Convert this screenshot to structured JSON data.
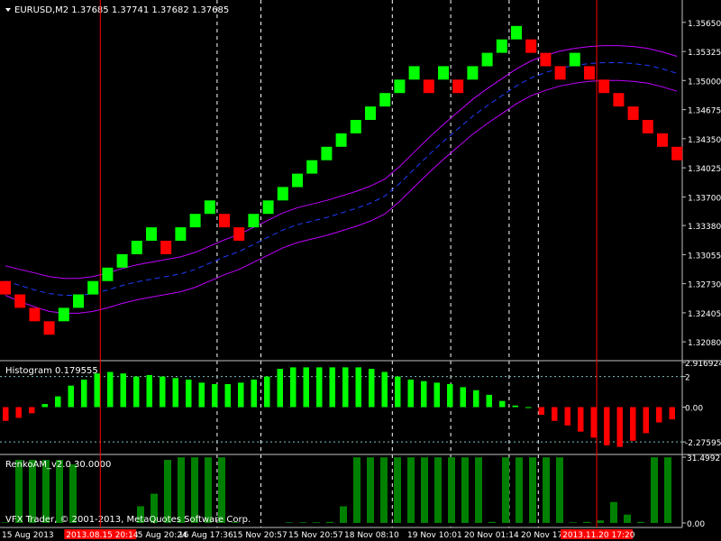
{
  "window": {
    "symbol_line": "EURUSD,M2  1.37685 1.37741 1.37682 1.37685",
    "copyright": "VFX Trader, © 2001-2013, MetaQuotes Software Corp."
  },
  "colors": {
    "background": "#000000",
    "up": "#00ff00",
    "down": "#ff0000",
    "hist_pos": "#00ff00",
    "hist_neg": "#ff0000",
    "renko_am": "#008000",
    "band": "#c000ff",
    "mid": "#1e3cff",
    "vline": "#ffffff",
    "marker": "#ff0000",
    "axis": "#c0c0c0"
  },
  "chart_data": [
    {
      "type": "renko",
      "title": "EURUSD,M2",
      "ylim": [
        1.3188,
        1.359
      ],
      "y_ticks": [
        "1.35650",
        "1.35325",
        "1.35000",
        "1.34675",
        "1.34350",
        "1.34025",
        "1.33700",
        "1.33380",
        "1.33055",
        "1.32730",
        "1.32405",
        "1.32080"
      ],
      "bricks": [
        {
          "d": "down",
          "o": 1.3276,
          "c": 1.3261
        },
        {
          "d": "down",
          "o": 1.3261,
          "c": 1.3246
        },
        {
          "d": "down",
          "o": 1.3246,
          "c": 1.3231
        },
        {
          "d": "down",
          "o": 1.3231,
          "c": 1.3216
        },
        {
          "d": "up",
          "o": 1.3231,
          "c": 1.3246
        },
        {
          "d": "up",
          "o": 1.3246,
          "c": 1.3261
        },
        {
          "d": "up",
          "o": 1.3261,
          "c": 1.3276
        },
        {
          "d": "up",
          "o": 1.3276,
          "c": 1.3291
        },
        {
          "d": "up",
          "o": 1.3291,
          "c": 1.3306
        },
        {
          "d": "up",
          "o": 1.3306,
          "c": 1.3321
        },
        {
          "d": "up",
          "o": 1.3321,
          "c": 1.3336
        },
        {
          "d": "down",
          "o": 1.3321,
          "c": 1.3306
        },
        {
          "d": "up",
          "o": 1.3321,
          "c": 1.3336
        },
        {
          "d": "up",
          "o": 1.3336,
          "c": 1.3351
        },
        {
          "d": "up",
          "o": 1.3351,
          "c": 1.3366
        },
        {
          "d": "down",
          "o": 1.3351,
          "c": 1.3336
        },
        {
          "d": "down",
          "o": 1.3336,
          "c": 1.3321
        },
        {
          "d": "up",
          "o": 1.3336,
          "c": 1.3351
        },
        {
          "d": "up",
          "o": 1.3351,
          "c": 1.3366
        },
        {
          "d": "up",
          "o": 1.3366,
          "c": 1.3381
        },
        {
          "d": "up",
          "o": 1.3381,
          "c": 1.3396
        },
        {
          "d": "up",
          "o": 1.3396,
          "c": 1.3411
        },
        {
          "d": "up",
          "o": 1.3411,
          "c": 1.3426
        },
        {
          "d": "up",
          "o": 1.3426,
          "c": 1.3441
        },
        {
          "d": "up",
          "o": 1.3441,
          "c": 1.3456
        },
        {
          "d": "up",
          "o": 1.3456,
          "c": 1.3471
        },
        {
          "d": "up",
          "o": 1.3471,
          "c": 1.3486
        },
        {
          "d": "up",
          "o": 1.3486,
          "c": 1.3501
        },
        {
          "d": "up",
          "o": 1.3501,
          "c": 1.3516
        },
        {
          "d": "down",
          "o": 1.3501,
          "c": 1.3486
        },
        {
          "d": "up",
          "o": 1.3501,
          "c": 1.3516
        },
        {
          "d": "down",
          "o": 1.3501,
          "c": 1.3486
        },
        {
          "d": "up",
          "o": 1.3501,
          "c": 1.3516
        },
        {
          "d": "up",
          "o": 1.3516,
          "c": 1.3531
        },
        {
          "d": "up",
          "o": 1.3531,
          "c": 1.3546
        },
        {
          "d": "up",
          "o": 1.3546,
          "c": 1.3561
        },
        {
          "d": "down",
          "o": 1.3546,
          "c": 1.3531
        },
        {
          "d": "down",
          "o": 1.3531,
          "c": 1.3516
        },
        {
          "d": "down",
          "o": 1.3516,
          "c": 1.3501
        },
        {
          "d": "up",
          "o": 1.3516,
          "c": 1.3531
        },
        {
          "d": "down",
          "o": 1.3516,
          "c": 1.3501
        },
        {
          "d": "down",
          "o": 1.3501,
          "c": 1.3486
        },
        {
          "d": "down",
          "o": 1.3486,
          "c": 1.3471
        },
        {
          "d": "down",
          "o": 1.3471,
          "c": 1.3456
        },
        {
          "d": "down",
          "o": 1.3456,
          "c": 1.3441
        },
        {
          "d": "down",
          "o": 1.3441,
          "c": 1.3426
        },
        {
          "d": "down",
          "o": 1.3426,
          "c": 1.3411
        }
      ],
      "bands": {
        "upper": [
          1.3293,
          1.3289,
          1.3285,
          1.3281,
          1.3279,
          1.3279,
          1.3281,
          1.3285,
          1.329,
          1.3294,
          1.3297,
          1.33,
          1.3303,
          1.3308,
          1.3315,
          1.3322,
          1.3328,
          1.3336,
          1.3344,
          1.3352,
          1.3358,
          1.3362,
          1.3366,
          1.3371,
          1.3376,
          1.3382,
          1.339,
          1.3404,
          1.342,
          1.3436,
          1.3451,
          1.3465,
          1.3479,
          1.3491,
          1.3502,
          1.3513,
          1.3522,
          1.3528,
          1.3533,
          1.3536,
          1.3538,
          1.3539,
          1.3539,
          1.3538,
          1.3536,
          1.3532,
          1.3527
        ],
        "mid": [
          1.3276,
          1.3271,
          1.3266,
          1.3262,
          1.326,
          1.326,
          1.3262,
          1.3266,
          1.3271,
          1.3275,
          1.3278,
          1.3281,
          1.3284,
          1.3289,
          1.3296,
          1.3303,
          1.3309,
          1.3317,
          1.3325,
          1.3333,
          1.3339,
          1.3343,
          1.3347,
          1.3352,
          1.3357,
          1.3363,
          1.3371,
          1.3385,
          1.3401,
          1.3417,
          1.3432,
          1.3446,
          1.346,
          1.3472,
          1.3483,
          1.3494,
          1.3503,
          1.3509,
          1.3514,
          1.3517,
          1.3519,
          1.352,
          1.352,
          1.3519,
          1.3517,
          1.3513,
          1.3508
        ],
        "lower": [
          1.326,
          1.3253,
          1.3247,
          1.3242,
          1.324,
          1.324,
          1.3242,
          1.3246,
          1.3251,
          1.3255,
          1.3258,
          1.3261,
          1.3264,
          1.3269,
          1.3276,
          1.3283,
          1.3289,
          1.3297,
          1.3305,
          1.3313,
          1.3319,
          1.3323,
          1.3327,
          1.3332,
          1.3337,
          1.3343,
          1.3351,
          1.3365,
          1.3381,
          1.3397,
          1.3412,
          1.3426,
          1.344,
          1.3452,
          1.3463,
          1.3474,
          1.3483,
          1.3489,
          1.3494,
          1.3497,
          1.3499,
          1.35,
          1.35,
          1.3499,
          1.3497,
          1.3493,
          1.3488
        ]
      },
      "dashed_vlines_at_brick": [
        14.5,
        17.5,
        26.5,
        30.5,
        34.5,
        36.5
      ],
      "marker_lines_at_brick": [
        6.5,
        40.5
      ]
    },
    {
      "type": "bar",
      "title": "Histogram 0.179555",
      "ylim": [
        -2.975,
        2.916924
      ],
      "y_ticks": [
        "2.916924",
        "2",
        "0.00",
        "-2.275955"
      ],
      "dotted_levels": [
        2,
        -2.275955
      ],
      "values": [
        -0.9,
        -0.7,
        -0.4,
        0.2,
        0.7,
        1.4,
        1.8,
        2.2,
        2.3,
        2.2,
        2.0,
        2.1,
        2.0,
        1.9,
        1.8,
        1.6,
        1.5,
        1.5,
        1.6,
        1.8,
        2.0,
        2.5,
        2.6,
        2.6,
        2.6,
        2.6,
        2.6,
        2.6,
        2.5,
        2.3,
        2.0,
        1.8,
        1.7,
        1.6,
        1.5,
        1.3,
        1.1,
        0.8,
        0.4,
        0.1,
        0.0,
        -0.5,
        -0.9,
        -1.2,
        -1.6,
        -2.0,
        -2.5,
        -2.6,
        -2.2,
        -1.7,
        -1.0,
        -0.8
      ]
    },
    {
      "type": "bar",
      "title": "RenkoAM_v2.0 30.0000",
      "ylim": [
        0,
        31.4992
      ],
      "y_ticks": [
        "31.4992",
        "0.00"
      ],
      "values": [
        0,
        0,
        0,
        0,
        0,
        0,
        0,
        0,
        0,
        0,
        0,
        0,
        0,
        0,
        0,
        0,
        0,
        0,
        0,
        0,
        0,
        0,
        0,
        0,
        0,
        0,
        0,
        0,
        0,
        0,
        0,
        0,
        0,
        0,
        0,
        0,
        0,
        0,
        0,
        0,
        0,
        0,
        0,
        0,
        0,
        0,
        0,
        0,
        0,
        0,
        0,
        0
      ],
      "bars": [
        {
          "v": 0.3
        },
        {
          "v": 30.2
        },
        {
          "v": 30.2
        },
        {
          "v": 30.2
        },
        {
          "v": 30.2
        },
        {
          "v": 28
        },
        {
          "v": 0
        },
        {
          "v": 0
        },
        {
          "v": 0
        },
        {
          "v": 0
        },
        {
          "v": 8
        },
        {
          "v": 14
        },
        {
          "v": 30.2
        },
        {
          "v": 31.4
        },
        {
          "v": 31.4
        },
        {
          "v": 31.4
        },
        {
          "v": 31.4
        },
        {
          "v": 0.4
        },
        {
          "v": 0
        },
        {
          "v": 0
        },
        {
          "v": 0
        },
        {
          "v": 0.3
        },
        {
          "v": 0.3
        },
        {
          "v": 0.3
        },
        {
          "v": 0.5
        },
        {
          "v": 8
        },
        {
          "v": 31.4
        },
        {
          "v": 31.4
        },
        {
          "v": 31.4
        },
        {
          "v": 31.4
        },
        {
          "v": 31.4
        },
        {
          "v": 31.4
        },
        {
          "v": 31.4
        },
        {
          "v": 31.4
        },
        {
          "v": 31.4
        },
        {
          "v": 31.4
        },
        {
          "v": 0.5
        },
        {
          "v": 31.4
        },
        {
          "v": 31.4
        },
        {
          "v": 31.4
        },
        {
          "v": 31.4
        },
        {
          "v": 31.4
        },
        {
          "v": 0.3
        },
        {
          "v": 0.5
        },
        {
          "v": 1.2
        },
        {
          "v": 10
        },
        {
          "v": 4
        },
        {
          "v": 0.5
        },
        {
          "v": 31.4
        },
        {
          "v": 31.4
        }
      ]
    }
  ],
  "x_axis": {
    "labels": [
      "15 Aug 2013",
      "15 Aug 20:14",
      "15 Aug 20:24",
      "16 Aug 17:36",
      "15 Nov 20:57",
      "15 Nov 20:57",
      "18 Nov 08:10",
      "19 Nov 10:01",
      "20 Nov 01:14",
      "20 Nov 17:22"
    ],
    "highlight_labels": [
      "2013.08.15 20:14",
      "2013.11.20 17:20"
    ]
  }
}
